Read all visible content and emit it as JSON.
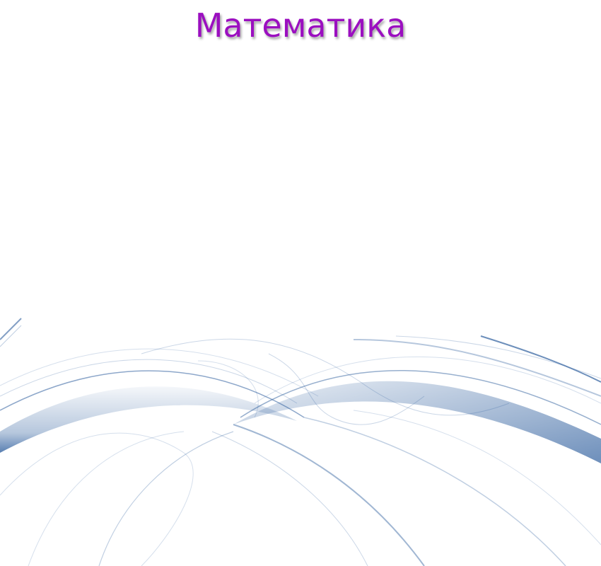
{
  "slide": {
    "title": "Математика",
    "title_color": "#9b0fc0",
    "wave_color": "#2f5f9e",
    "background": "#ffffff"
  }
}
